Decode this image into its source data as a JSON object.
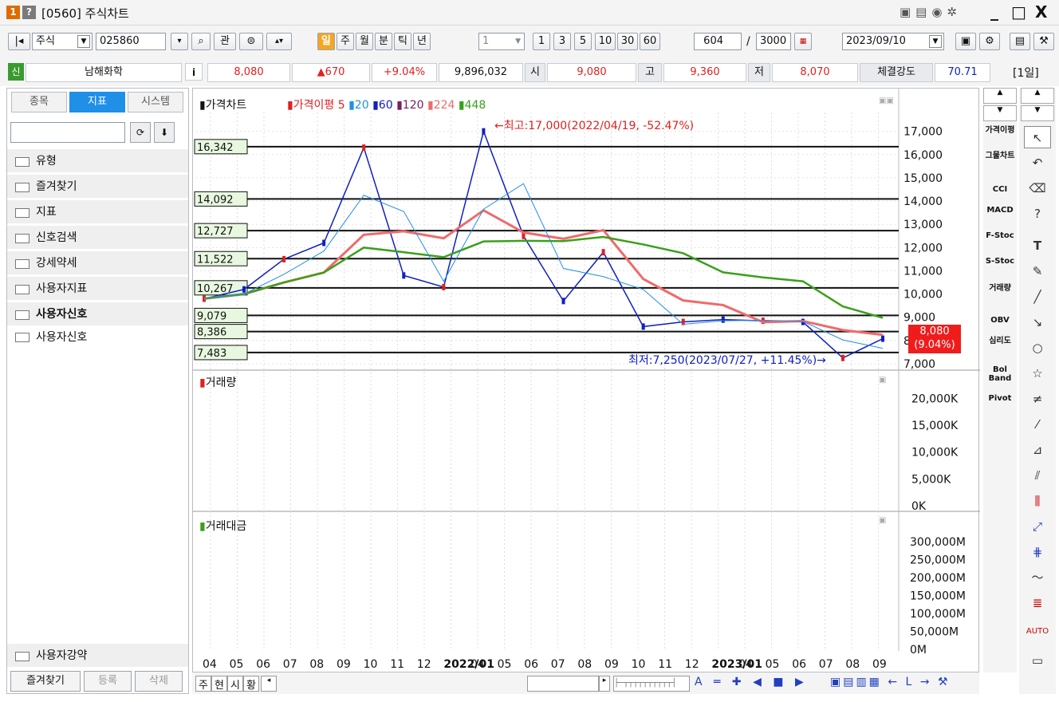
{
  "window": {
    "badge1": "1",
    "badge2": "?",
    "title": "[0560] 주식차트",
    "ctrl_min": "_",
    "ctrl_max": "□",
    "ctrl_close": "X"
  },
  "toolbar": {
    "market": "주식",
    "code": "025860",
    "watch": "관",
    "period_day": "일",
    "period_week": "주",
    "period_month": "월",
    "period_min": "분",
    "period_tick": "틱",
    "period_year": "년",
    "unit": "1",
    "quick": [
      "1",
      "3",
      "5",
      "10",
      "30",
      "60"
    ],
    "count": "604",
    "total": "3000",
    "date": "2023/09/10"
  },
  "quote": {
    "name_tag": "신",
    "name": "남해화학",
    "info": "i",
    "price": "8,080",
    "change": "▲670",
    "pct": "+9.04%",
    "volume": "9,896,032",
    "open_label": "시",
    "open": "9,080",
    "high_label": "고",
    "high": "9,360",
    "low_label": "저",
    "low": "8,070",
    "strength_label": "체결강도",
    "strength": "70.71",
    "span": "[1일]"
  },
  "left": {
    "tabs": [
      "종목",
      "지표",
      "시스템"
    ],
    "folders": [
      "유형",
      "즐겨찾기",
      "지표",
      "신호검색",
      "강세약세",
      "사용자지표",
      "사용자신호"
    ],
    "subitem": "사용자신호",
    "bottom_folder": "사용자강약",
    "btn_fav": "즐겨찾기",
    "btn_add": "등록",
    "btn_del": "삭제"
  },
  "chart_data": [
    {
      "type": "line",
      "title": "가격차트",
      "legend": [
        "가격이평",
        "5",
        "20",
        "60",
        "120",
        "224",
        "448"
      ],
      "yticks": [
        "17,000",
        "16,000",
        "15,000",
        "14,000",
        "13,000",
        "12,000",
        "11,000",
        "10,000",
        "9,000",
        "8,000",
        "7,000"
      ],
      "levels": [
        "16,342",
        "14,092",
        "12,727",
        "11,522",
        "10,267",
        "9,079",
        "8,386",
        "7,483"
      ],
      "high_note": "←최고:17,000(2022/04/19, -52.47%)",
      "low_note": "최저:7,250(2023/07/27, +11.45%)→",
      "last_price": "8,080",
      "last_pct": "(9.04%)",
      "x": [
        "2021/04",
        "2021/06",
        "2021/08",
        "2021/10",
        "2021/11",
        "2021/12",
        "2022/02",
        "2022/04",
        "2022/05",
        "2022/07",
        "2022/08",
        "2022/09",
        "2022/11",
        "2023/01",
        "2023/03",
        "2023/05",
        "2023/07",
        "2023/09"
      ],
      "close": [
        9800,
        10200,
        11500,
        12200,
        16300,
        10800,
        10300,
        17000,
        12500,
        9700,
        11800,
        8600,
        8800,
        8900,
        8850,
        8800,
        7250,
        8080
      ]
    },
    {
      "type": "bar",
      "title": "거래량",
      "yticks": [
        "20,000K",
        "15,000K",
        "10,000K",
        "5,000K",
        "0K"
      ]
    },
    {
      "type": "bar",
      "title": "거래대금",
      "yticks": [
        "300,000M",
        "250,000M",
        "200,000M",
        "150,000M",
        "100,000M",
        "50,000M",
        "0M"
      ]
    }
  ],
  "xaxis": [
    "04",
    "05",
    "06",
    "07",
    "08",
    "09",
    "10",
    "11",
    "12",
    "2022/01",
    "04",
    "05",
    "06",
    "07",
    "08",
    "09",
    "10",
    "11",
    "12",
    "2023/01",
    "04",
    "05",
    "06",
    "07",
    "08",
    "09"
  ],
  "bottom": {
    "tabs": [
      "주",
      "현",
      "시",
      "황"
    ]
  },
  "indicators": [
    "가격이평",
    "그물차트",
    "CCI",
    "MACD",
    "F-Stoc",
    "S-Stoc",
    "거래량",
    "OBV",
    "심리도",
    "Bol Band",
    "Pivot"
  ],
  "colors": {
    "up": "#e02020",
    "down": "#1020c0",
    "accent": "#1f8fe8",
    "green": "#3aa01a"
  }
}
